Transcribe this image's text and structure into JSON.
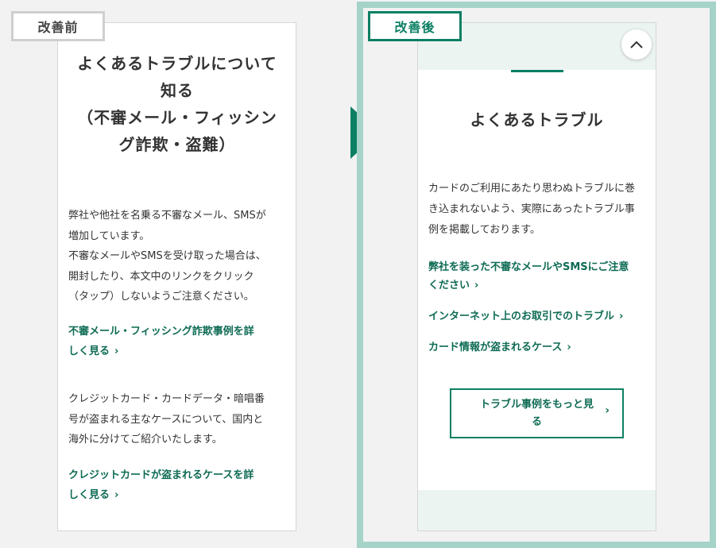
{
  "before": {
    "tag": "改善前",
    "title_lines": [
      "よくあるトラブルについて",
      "知る",
      "（不審メール・フィッシン",
      "グ詐欺・盗難）"
    ],
    "para1_lines": [
      "弊社や他社を名乗る不審なメール、SMSが",
      "増加しています。",
      "不審なメールやSMSを受け取った場合は、",
      "開封したり、本文中のリンクをクリック",
      "（タップ）しないようご注意ください。"
    ],
    "link1_lines": [
      "不審メール・フィッシング詐欺事例を詳",
      "しく見る"
    ],
    "para2_lines": [
      "クレジットカード・カードデータ・暗唱番",
      "号が盗まれる主なケースについて、国内と",
      "海外に分けてご紹介いたします。"
    ],
    "link2_lines": [
      "クレジットカードが盗まれるケースを詳",
      "しく見る"
    ],
    "chevron": "›"
  },
  "after": {
    "tag": "改善後",
    "title": "よくあるトラブル",
    "para_lines": [
      "カードのご利用にあたり思わぬトラブルに巻",
      "き込まれないよう、実際にあったトラブル事",
      "例を掲載しております。"
    ],
    "link1_lines": [
      "弊社を装った不審なメールやSMSにご注意",
      "ください"
    ],
    "link2": "インターネット上のお取引でのトラブル",
    "link3": "カード情報が盗まれるケース",
    "more_button_lines": [
      "トラブル事例をもっと見",
      "る"
    ],
    "chevron": "›"
  },
  "colors": {
    "accent": "#0c7f63",
    "link": "#0e6b54",
    "frame": "#a5d3c8",
    "band": "#ecf4f1"
  }
}
